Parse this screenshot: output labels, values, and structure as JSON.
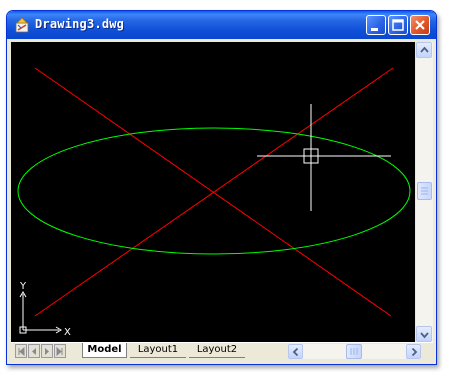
{
  "window": {
    "title": "Drawing3.dwg",
    "controls": [
      "minimize-icon",
      "maximize-icon",
      "close-icon"
    ]
  },
  "drawing": {
    "background_color": "#000000",
    "line_color": "#FF0000",
    "ellipse_color": "#00FF00",
    "cursor_color": "#FFFFFF",
    "ucs": {
      "x_label": "X",
      "y_label": "Y"
    }
  },
  "layout_tabs": [
    {
      "label": "Model",
      "active": true
    },
    {
      "label": "Layout1",
      "active": false
    },
    {
      "label": "Layout2",
      "active": false
    }
  ],
  "scrollbars": {
    "vertical": {
      "up_icon": "arrow-up-icon",
      "down_icon": "arrow-down-icon"
    },
    "horizontal": {
      "left_icon": "arrow-left-icon",
      "right_icon": "arrow-right-icon"
    }
  }
}
